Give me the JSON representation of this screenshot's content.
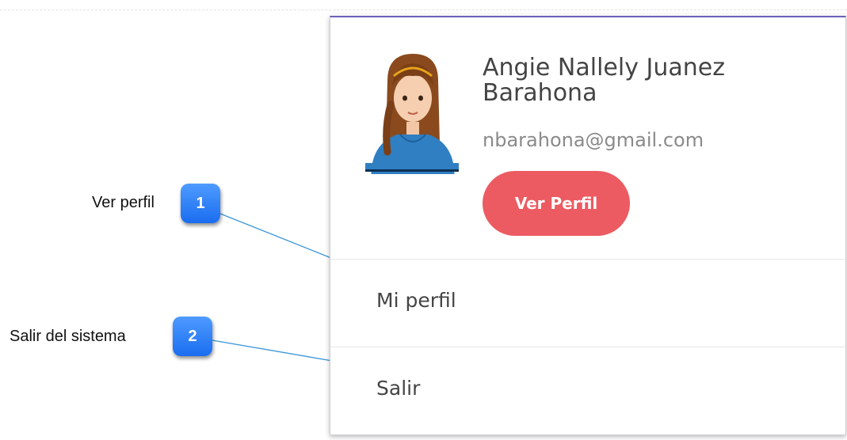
{
  "user": {
    "name": "Angie Nallely Juanez Barahona",
    "email": "nbarahona@gmail.com",
    "view_profile_label": "Ver Perfil"
  },
  "menu": {
    "items": [
      {
        "label": "Mi perfil"
      },
      {
        "label": "Salir"
      }
    ]
  },
  "callouts": [
    {
      "number": "1",
      "label": "Ver perfil"
    },
    {
      "number": "2",
      "label": "Salir del sistema"
    }
  ],
  "colors": {
    "accent_button": "#ec5b62",
    "panel_top_border": "#6c62b8",
    "callout_badge": "#1a6df0",
    "connector_line": "#3a95d8"
  }
}
